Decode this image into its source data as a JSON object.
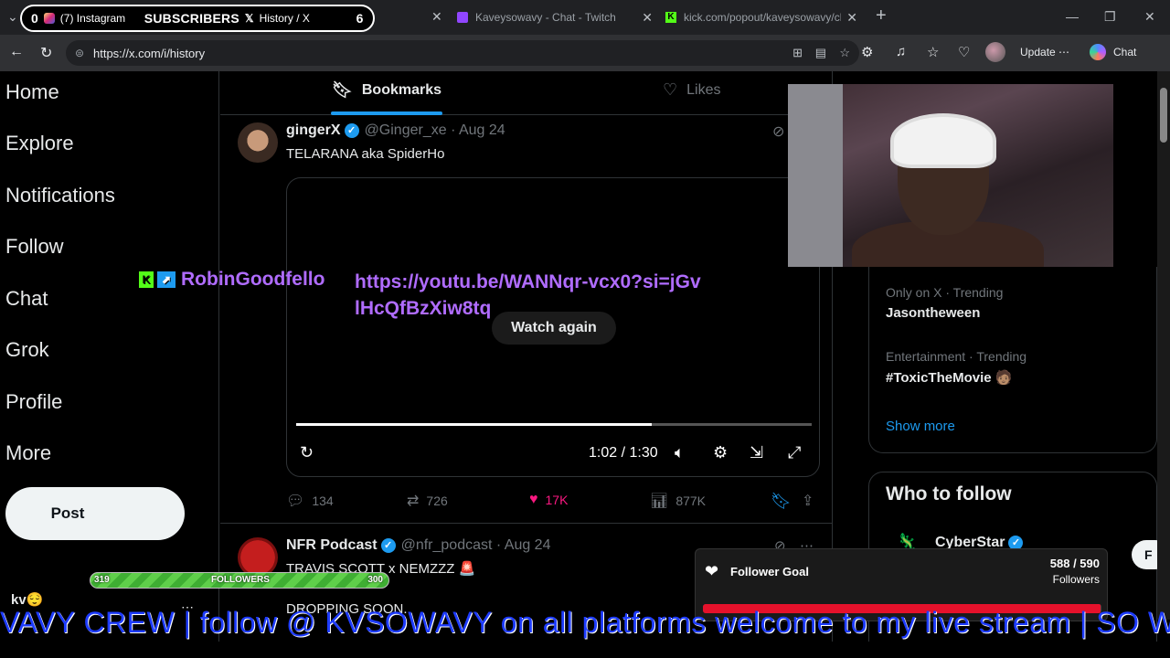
{
  "browser": {
    "tabs": [
      {
        "label": "Kaveysowavy - Chat - Twitch"
      },
      {
        "label": "kick.com/popout/kaveysowavy/ch"
      }
    ],
    "overlay_pill": {
      "subs_count": "0",
      "instagram_label": "(7) Instagram",
      "subs_label": "SUBSCRIBERS",
      "x_tab_label": "History / X",
      "subs_goal": "6"
    },
    "url": "https://x.com/i/history",
    "update_label": "Update",
    "chat_label": "Chat"
  },
  "leftnav": {
    "items": [
      "Home",
      "Explore",
      "Notifications",
      "Follow",
      "Chat",
      "Grok",
      "Profile",
      "More"
    ],
    "post_label": "Post",
    "user_stub": "kv😌"
  },
  "feed": {
    "tabs": [
      {
        "label": "Bookmarks"
      },
      {
        "label": "Likes"
      }
    ],
    "tweet1": {
      "name": "gingerX",
      "handle": "@Ginger_xe · Aug 24",
      "text": "TELARANA aka SpiderHo",
      "watch_again": "Watch again",
      "time": "1:02 / 1:30",
      "progress": 0.69,
      "replies": "134",
      "reposts": "726",
      "likes": "17K",
      "views": "877K"
    },
    "tweet2": {
      "name": "NFR Podcast",
      "handle": "@nfr_podcast · Aug 24",
      "text": "TRAVIS SCOTT x NEMZZZ 🚨",
      "text2": "DROPPING SOON."
    }
  },
  "chat_overlay": {
    "user": "RobinGoodfello",
    "message": "https://youtu.be/WANNqr-vcx0?si=jGvlHcQfBzXiw8tq"
  },
  "sidebar": {
    "trends": [
      {
        "meta": "Only on X · Trending",
        "name": "Jasontheween"
      },
      {
        "meta": "Entertainment · Trending",
        "name": "#ToxicTheMovie 🧑🏽"
      }
    ],
    "show_more": "Show more",
    "who_to_follow": "Who to follow",
    "suggest_name": "CyberStar",
    "follow_label": "F"
  },
  "stream": {
    "followers_bar": {
      "current": "319",
      "label": "FOLLOWERS",
      "target": "300",
      "fill": 1.0
    },
    "goal": {
      "title": "Follower Goal",
      "count": "588 / 590",
      "unit": "Followers",
      "fill": 0.997
    },
    "ticker": "VAVY CREW  | follow @ KVSOWAVY on all platforms welcome to my live stream | SO W"
  },
  "colors": {
    "accent": "#1d9bf0",
    "like": "#f91880",
    "chat_name": "#b06cff",
    "goal_bar": "#e5112b",
    "ticker": "#1e3cff"
  }
}
